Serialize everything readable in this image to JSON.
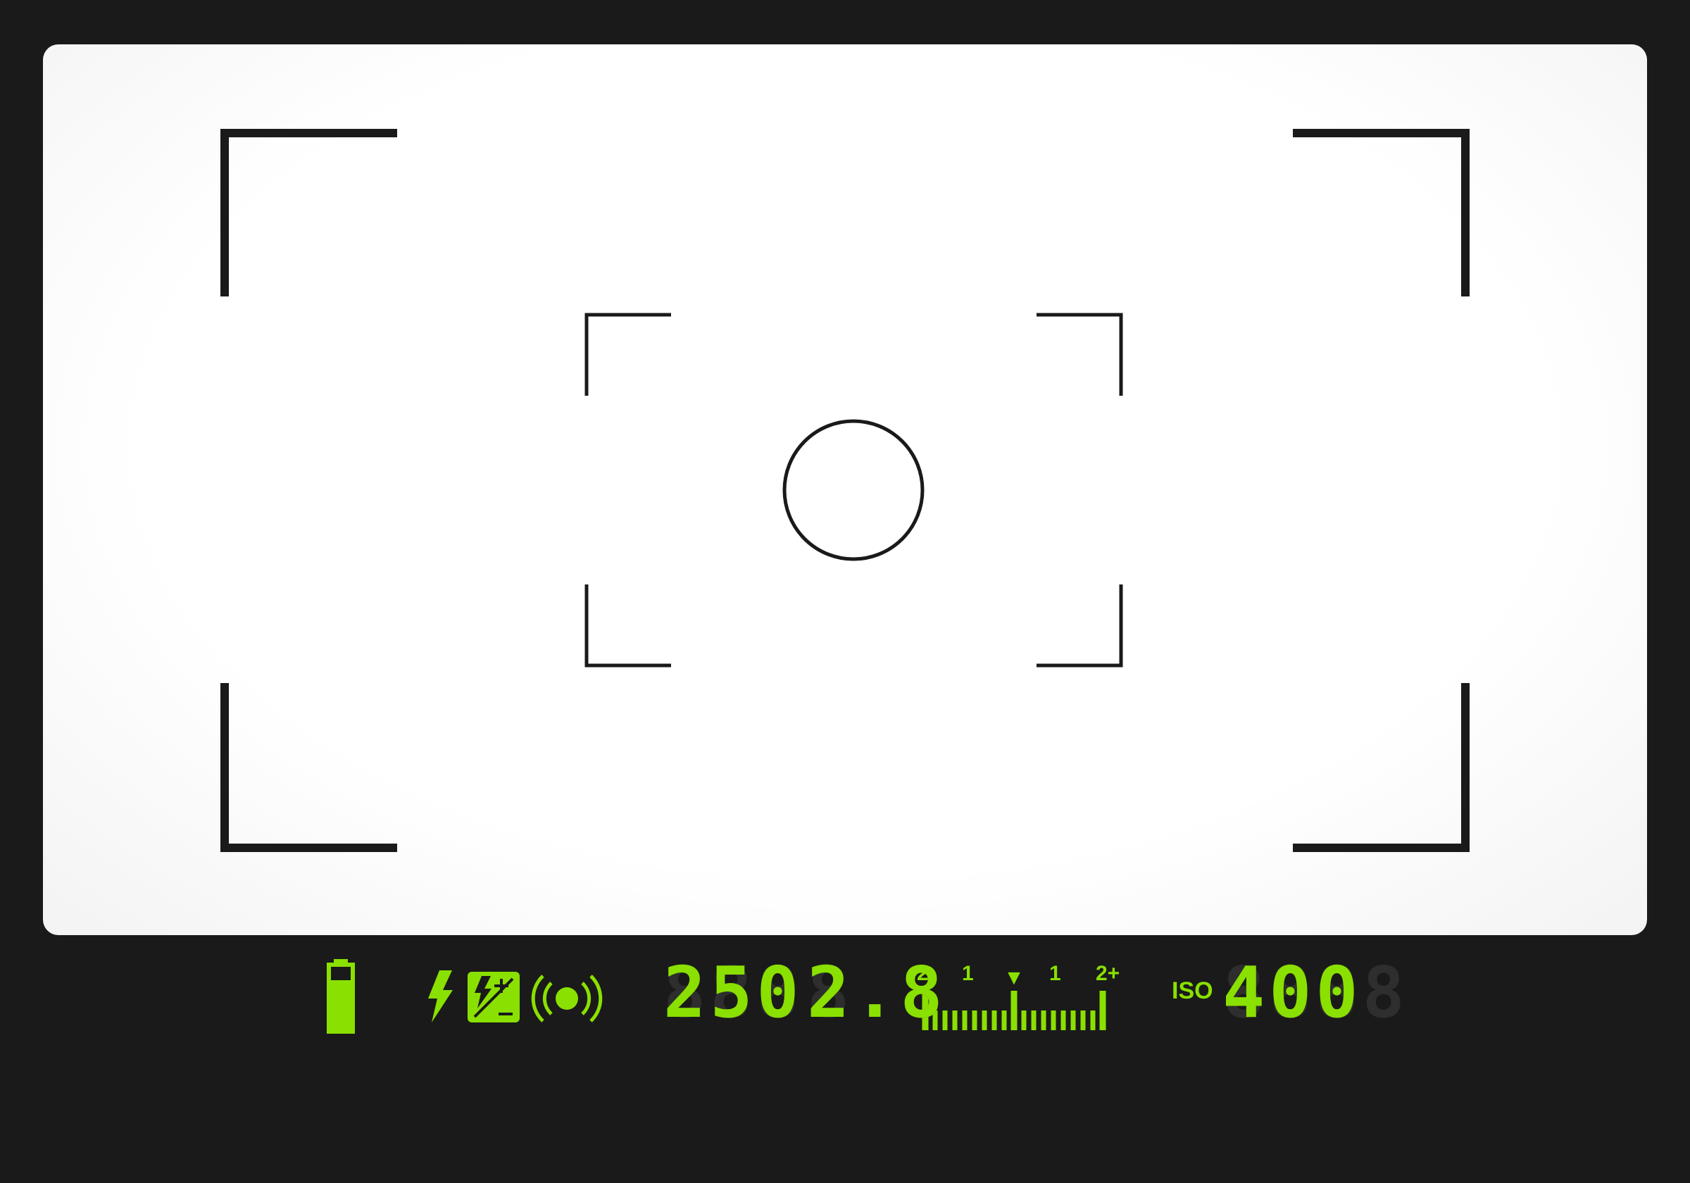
{
  "viewfinder": {
    "shutter_speed": "250",
    "shutter_speed_ghost": "888",
    "aperture": "2.8",
    "aperture_ghost": "8.8",
    "iso_label": "ISO",
    "iso_value": "400",
    "iso_ghost": "8888",
    "exposure_scale": {
      "labels": [
        "-2",
        "1",
        "1",
        "2+"
      ],
      "indicator": "▼",
      "current_ev": 0
    },
    "battery_level": 0.8,
    "icons": [
      "battery-icon",
      "flash-icon",
      "flash-compensation-icon",
      "stabilizer-icon"
    ],
    "colors": {
      "lcd_green": "#8ae000",
      "lcd_off": "#2e2e2e",
      "frame_lines": "#1a1a1a",
      "screen": "#ffffff",
      "bezel": "#1a1a1a"
    }
  }
}
